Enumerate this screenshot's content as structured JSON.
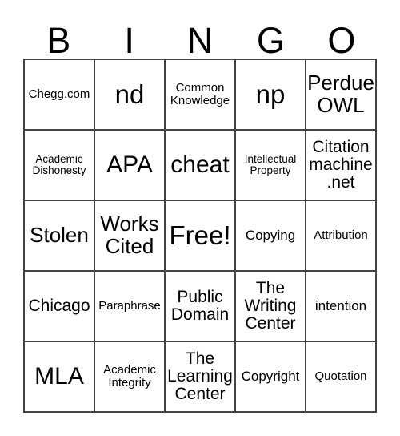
{
  "header": {
    "letters": [
      "B",
      "I",
      "N",
      "G",
      "O"
    ]
  },
  "grid": {
    "rows": [
      [
        {
          "label": "Chegg.com",
          "size": "xs"
        },
        {
          "label": "nd",
          "size": "xxl"
        },
        {
          "label": "Common Knowledge",
          "size": "xs"
        },
        {
          "label": "np",
          "size": "xxl"
        },
        {
          "label": "Perdue OWL",
          "size": "lg"
        }
      ],
      [
        {
          "label": "Academic Dishonesty",
          "size": "xxs"
        },
        {
          "label": "APA",
          "size": "xl"
        },
        {
          "label": "cheat",
          "size": "xl"
        },
        {
          "label": "Intellectual Property",
          "size": "xxs"
        },
        {
          "label": "Citation machine .net",
          "size": "md"
        }
      ],
      [
        {
          "label": "Stolen",
          "size": "lg"
        },
        {
          "label": "Works Cited",
          "size": "lg"
        },
        {
          "label": "Free!",
          "size": "xxl"
        },
        {
          "label": "Copying",
          "size": "sm"
        },
        {
          "label": "Attribution",
          "size": "xs"
        }
      ],
      [
        {
          "label": "Chicago",
          "size": "md"
        },
        {
          "label": "Paraphrase",
          "size": "xs"
        },
        {
          "label": "Public Domain",
          "size": "md"
        },
        {
          "label": "The Writing Center",
          "size": "md"
        },
        {
          "label": "intention",
          "size": "sm"
        }
      ],
      [
        {
          "label": "MLA",
          "size": "xl"
        },
        {
          "label": "Academic Integrity",
          "size": "xs"
        },
        {
          "label": "The Learning Center",
          "size": "md"
        },
        {
          "label": "Copyright",
          "size": "sm"
        },
        {
          "label": "Quotation",
          "size": "xs"
        }
      ]
    ]
  }
}
